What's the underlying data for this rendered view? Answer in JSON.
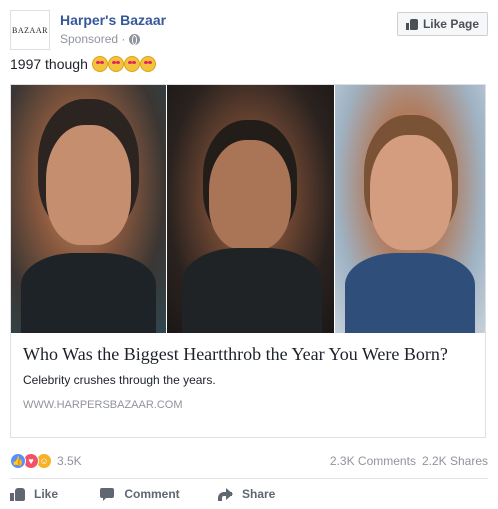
{
  "page": {
    "name": "Harper's Bazaar",
    "logo_text": "BAZAAR",
    "sponsored_label": "Sponsored ·",
    "like_page_label": "Like Page"
  },
  "post": {
    "text": "1997 though",
    "emojis": [
      "heart-eyes-emoji",
      "heart-eyes-emoji",
      "heart-eyes-emoji",
      "heart-eyes-emoji"
    ]
  },
  "card": {
    "title": "Who Was the Biggest Heartthrob the Year You Were Born?",
    "description": "Celebrity crushes through the years.",
    "url": "WWW.HARPERSBAZAAR.COM"
  },
  "stats": {
    "reactions_count": "3.5K",
    "comments": "2.3K Comments",
    "shares": "2.2K Shares"
  },
  "actions": {
    "like": "Like",
    "comment": "Comment",
    "share": "Share"
  },
  "colors": {
    "link_blue": "#365899",
    "meta_gray": "#90949c",
    "like_blue": "#5890ff",
    "love_red": "#f25268",
    "haha_yellow": "#f7b125"
  }
}
